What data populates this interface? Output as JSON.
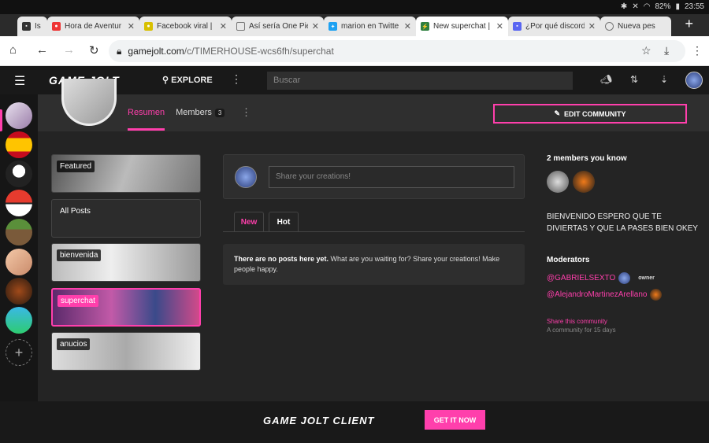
{
  "status": {
    "battery": "82%",
    "time": "23:55"
  },
  "tabs": [
    {
      "title": "Is D",
      "active": false
    },
    {
      "title": "Hora de Aventur",
      "active": false
    },
    {
      "title": "Facebook viral |",
      "active": false
    },
    {
      "title": "Así sería One Pie",
      "active": false
    },
    {
      "title": "marion en Twitte",
      "active": false
    },
    {
      "title": "New superchat |",
      "active": true
    },
    {
      "title": "¿Por qué discord",
      "active": false
    },
    {
      "title": "Nueva pes",
      "active": false
    }
  ],
  "address": {
    "domain": "gamejolt.com",
    "path": "/c/TIMERHOUSE-wcs6fh/superchat"
  },
  "nav": {
    "logo": "GAME JOLT",
    "explore": "EXPLORE",
    "search_placeholder": "Buscar"
  },
  "header": {
    "tab_overview": "Resumen",
    "tab_members": "Members",
    "members_count": "3",
    "edit_label": "EDIT COMMUNITY"
  },
  "channels": [
    {
      "label": "Featured",
      "selected": false
    },
    {
      "label": "All Posts",
      "selected": false
    },
    {
      "label": "bienvenida",
      "selected": false
    },
    {
      "label": "superchat",
      "selected": true
    },
    {
      "label": "anucios",
      "selected": false
    }
  ],
  "feed": {
    "composer_placeholder": "Share your creations!",
    "tab_new": "New",
    "tab_hot": "Hot",
    "empty_bold": "There are no posts here yet.",
    "empty_rest": " What are you waiting for? Share your creations! Make people happy."
  },
  "sidebar": {
    "members_title": "2 members you know",
    "welcome": "BIENVENIDO ESPERO QUE TE DIVIERTAS Y QUE LA PASES BIEN OKEY",
    "moderators_title": "Moderators",
    "mod1": "@GABRIELSEXTO",
    "mod1_role": "owner",
    "mod2": "@AlejandroMartinezArellano",
    "share": "Share this community",
    "since": "A community for 15 days"
  },
  "banner": {
    "logo": "GAME JOLT CLIENT",
    "cta": "GET IT NOW"
  },
  "colors": {
    "accent": "#ff3fac",
    "bg": "#242424"
  }
}
